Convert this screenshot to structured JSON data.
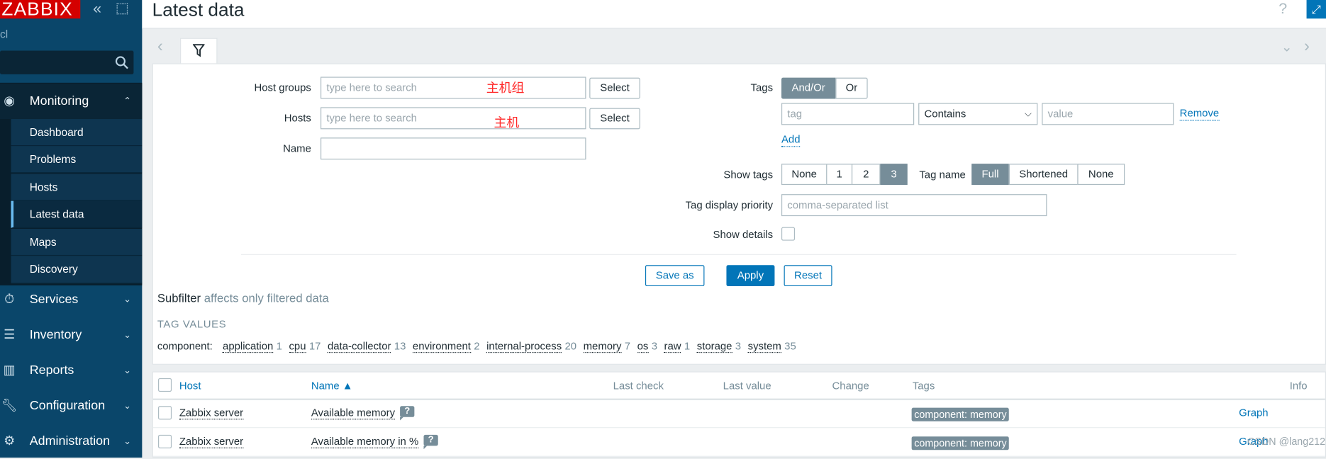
{
  "sidebar": {
    "logo": "ZABBIX",
    "server_name": "cl",
    "menu": [
      {
        "label": "Monitoring",
        "icon": "eye-icon",
        "expanded": true
      },
      {
        "label": "Services",
        "icon": "stopwatch-icon"
      },
      {
        "label": "Inventory",
        "icon": "list-icon"
      },
      {
        "label": "Reports",
        "icon": "bar-chart-icon"
      },
      {
        "label": "Configuration",
        "icon": "wrench-icon"
      },
      {
        "label": "Administration",
        "icon": "gear-icon"
      }
    ],
    "submenu": [
      "Dashboard",
      "Problems",
      "Hosts",
      "Latest data",
      "Maps",
      "Discovery"
    ],
    "active_submenu": "Latest data"
  },
  "header": {
    "title": "Latest data",
    "help": "?"
  },
  "filter": {
    "host_groups_label": "Host groups",
    "hosts_label": "Hosts",
    "name_label": "Name",
    "search_placeholder": "type here to search",
    "select_label": "Select",
    "annotation_host_groups": "主机组",
    "annotation_hosts": "主机",
    "name_value": "",
    "tags_label": "Tags",
    "tags_mode": [
      "And/Or",
      "Or"
    ],
    "tags_mode_selected": "And/Or",
    "tag_placeholder": "tag",
    "operator": "Contains",
    "value_placeholder": "value",
    "remove_label": "Remove",
    "add_label": "Add",
    "show_tags_label": "Show tags",
    "show_tags_options": [
      "None",
      "1",
      "2",
      "3"
    ],
    "show_tags_selected": "3",
    "tag_name_label": "Tag name",
    "tag_name_options": [
      "Full",
      "Shortened",
      "None"
    ],
    "tag_name_selected": "Full",
    "tag_priority_label": "Tag display priority",
    "tag_priority_placeholder": "comma-separated list",
    "show_details_label": "Show details",
    "show_details_checked": false,
    "save_as": "Save as",
    "apply": "Apply",
    "reset": "Reset"
  },
  "subfilter": {
    "title": "Subfilter",
    "note": "affects only filtered data",
    "section": "TAG VALUES",
    "tag_name": "component:",
    "values": [
      {
        "label": "application",
        "count": "1"
      },
      {
        "label": "cpu",
        "count": "17"
      },
      {
        "label": "data-collector",
        "count": "13"
      },
      {
        "label": "environment",
        "count": "2"
      },
      {
        "label": "internal-process",
        "count": "20"
      },
      {
        "label": "memory",
        "count": "7"
      },
      {
        "label": "os",
        "count": "3"
      },
      {
        "label": "raw",
        "count": "1"
      },
      {
        "label": "storage",
        "count": "3"
      },
      {
        "label": "system",
        "count": "35"
      }
    ]
  },
  "table": {
    "columns": [
      "Host",
      "Name ▲",
      "Last check",
      "Last value",
      "Change",
      "Tags",
      "Info"
    ],
    "rows": [
      {
        "host": "Zabbix server",
        "name": "Available memory",
        "last_check": "",
        "last_value": "",
        "change": "",
        "tag": "component: memory",
        "link": "Graph"
      },
      {
        "host": "Zabbix server",
        "name": "Available memory in %",
        "last_check": "",
        "last_value": "",
        "change": "",
        "tag": "component: memory",
        "link": "Graph"
      }
    ]
  },
  "watermark": "CSDN @lang212"
}
